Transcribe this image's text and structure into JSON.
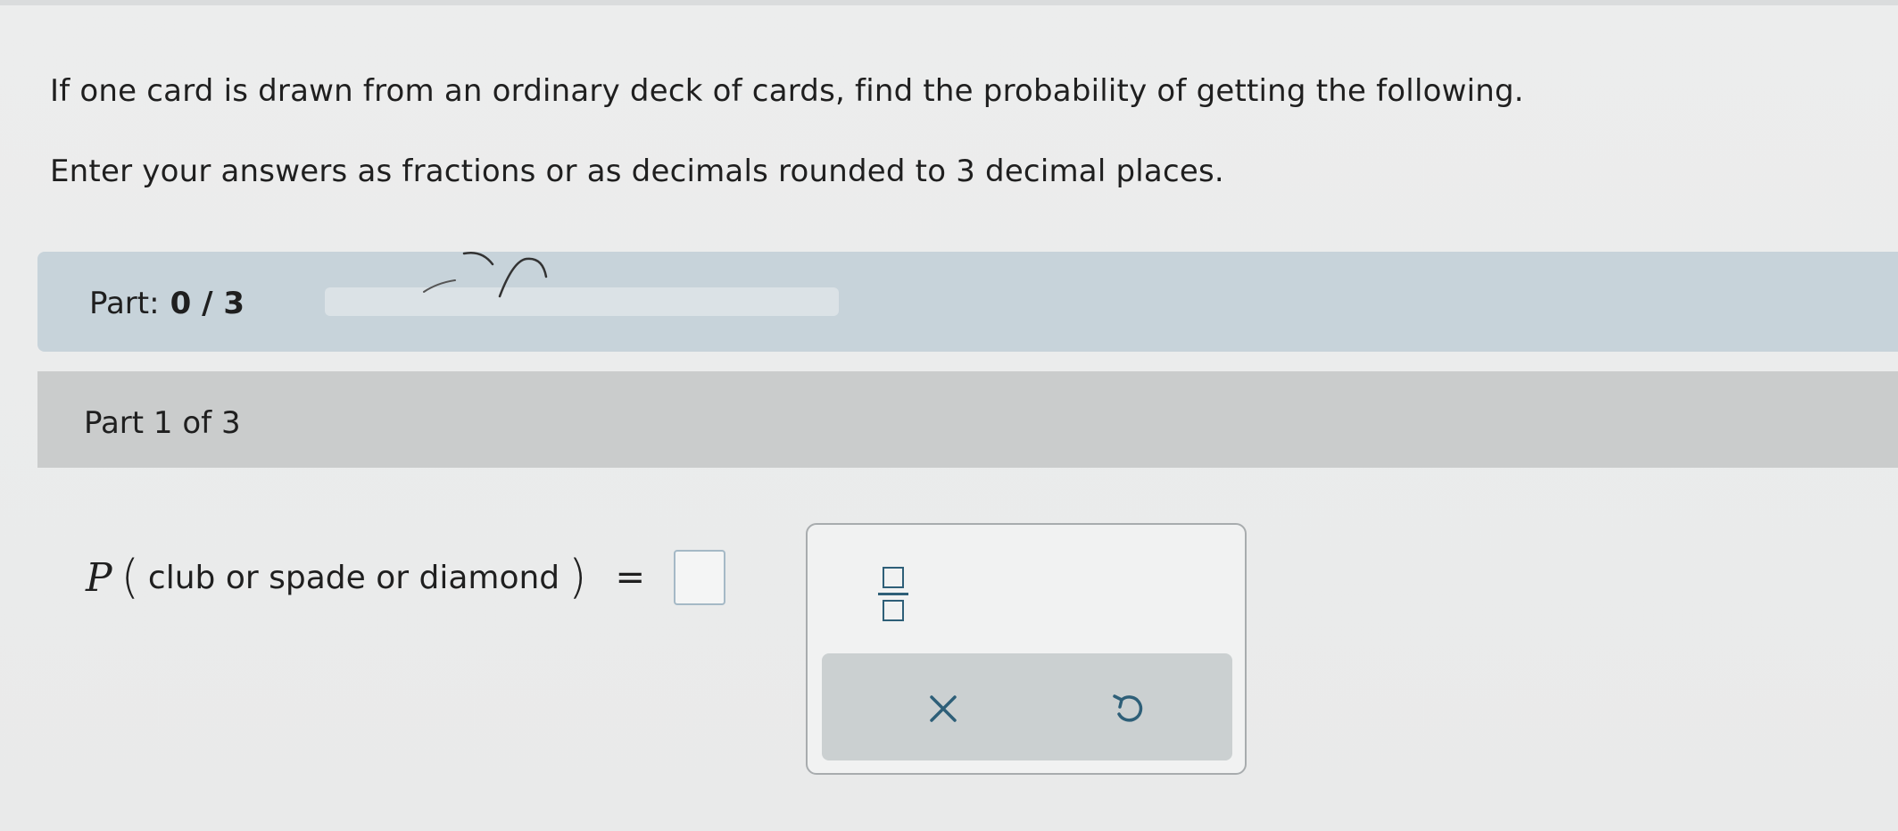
{
  "question": {
    "line1": "If one card is drawn from an ordinary deck of cards, find the probability of getting the following.",
    "line2": "Enter your answers as fractions or as decimals rounded to 3 decimal places."
  },
  "progress": {
    "label": "Part:",
    "value": "0 / 3",
    "fraction_complete": 0
  },
  "part": {
    "title": "Part 1 of 3"
  },
  "expression": {
    "symbol": "P",
    "open_paren": "(",
    "event": "club or spade or diamond",
    "close_paren": ")",
    "equals": "="
  },
  "keypad": {
    "icons": {
      "fraction": "fraction-template-icon",
      "clear": "close-x-icon",
      "undo": "undo-arrow-icon"
    }
  },
  "colors": {
    "accent": "#2e5f78",
    "progress_bar": "#c7d3da",
    "part_header": "#cacccc"
  }
}
